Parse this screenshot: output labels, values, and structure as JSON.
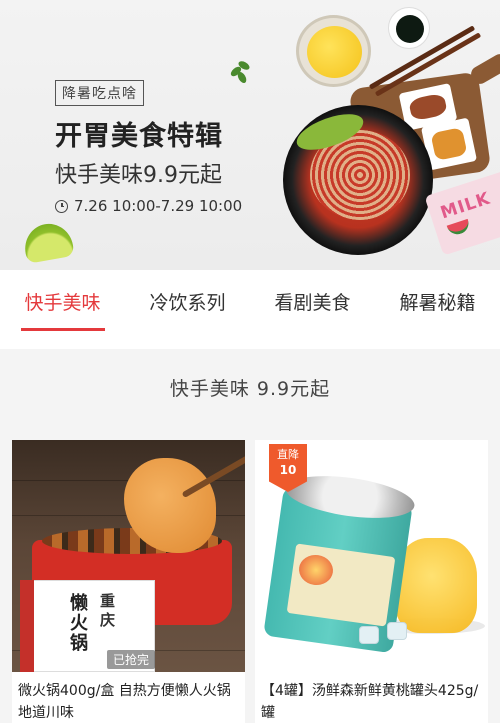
{
  "banner": {
    "tag": "降暑吃点啥",
    "title": "开胃美食特辑",
    "subtitle": "快手美味9.9元起",
    "time": "7.26 10:00-7.29 10:00",
    "milk_text": "MILK"
  },
  "tabs": [
    {
      "label": "快手美味",
      "active": true
    },
    {
      "label": "冷饮系列",
      "active": false
    },
    {
      "label": "看剧美食",
      "active": false
    },
    {
      "label": "解暑秘籍",
      "active": false
    }
  ],
  "section": {
    "title": "快手美味   9.9元起"
  },
  "products": [
    {
      "name": "微火锅400g/盒 自热方便懒人火锅 地道川味",
      "box_text_1": "懒火锅",
      "box_text_2": "重庆",
      "status": "已抢完"
    },
    {
      "name": "【4罐】汤鲜森新鲜黄桃罐头425g/罐",
      "badge_top": "直降",
      "badge_value": "10"
    }
  ],
  "colors": {
    "accent": "#e4393c",
    "badge": "#ef5a2c"
  }
}
